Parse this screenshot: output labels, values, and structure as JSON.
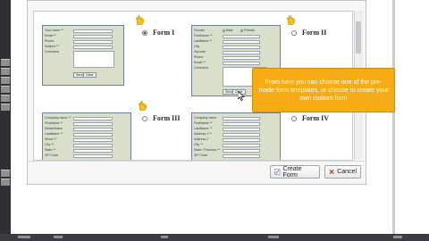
{
  "forms": [
    {
      "id": "I",
      "label": "Form I",
      "selected": true,
      "fields": [
        "Your name **",
        "Email **",
        "Phone",
        "Subject **",
        "Comment"
      ],
      "buttons": [
        "Send",
        "Clear"
      ]
    },
    {
      "id": "II",
      "label": "Form II",
      "selected": false,
      "gender_label": "Gender",
      "gender_options": [
        "Male",
        "Female"
      ],
      "fields": [
        "FirstName **",
        "LastName **",
        "City",
        "Zipcode",
        "Phone",
        "Email **",
        "Comment"
      ],
      "buttons": [
        "Send",
        "Clear"
      ]
    },
    {
      "id": "III",
      "label": "Form III",
      "selected": false,
      "fields": [
        "Company name **",
        "FirstName **",
        "MiddleName",
        "LastName **",
        "Street **",
        "City **",
        "State **",
        "ZIP Code"
      ]
    },
    {
      "id": "IV",
      "label": "Form IV",
      "selected": false,
      "fields": [
        "Company name",
        "FirstName **",
        "LastName **",
        "Address 1 **",
        "Address 2",
        "City **",
        "State / Province **",
        "ZIP Code"
      ]
    }
  ],
  "tooltip": {
    "text": "From here you can choose one of the pre-made form templates, or choose to create your own custom form"
  },
  "dialog_buttons": {
    "create_label": "Create Form",
    "cancel_label": "Cancel"
  },
  "colors": {
    "form_bg": "#d9dfc9",
    "tooltip_bg": "#f6ac14",
    "hand_icon": "#f3c21a"
  }
}
